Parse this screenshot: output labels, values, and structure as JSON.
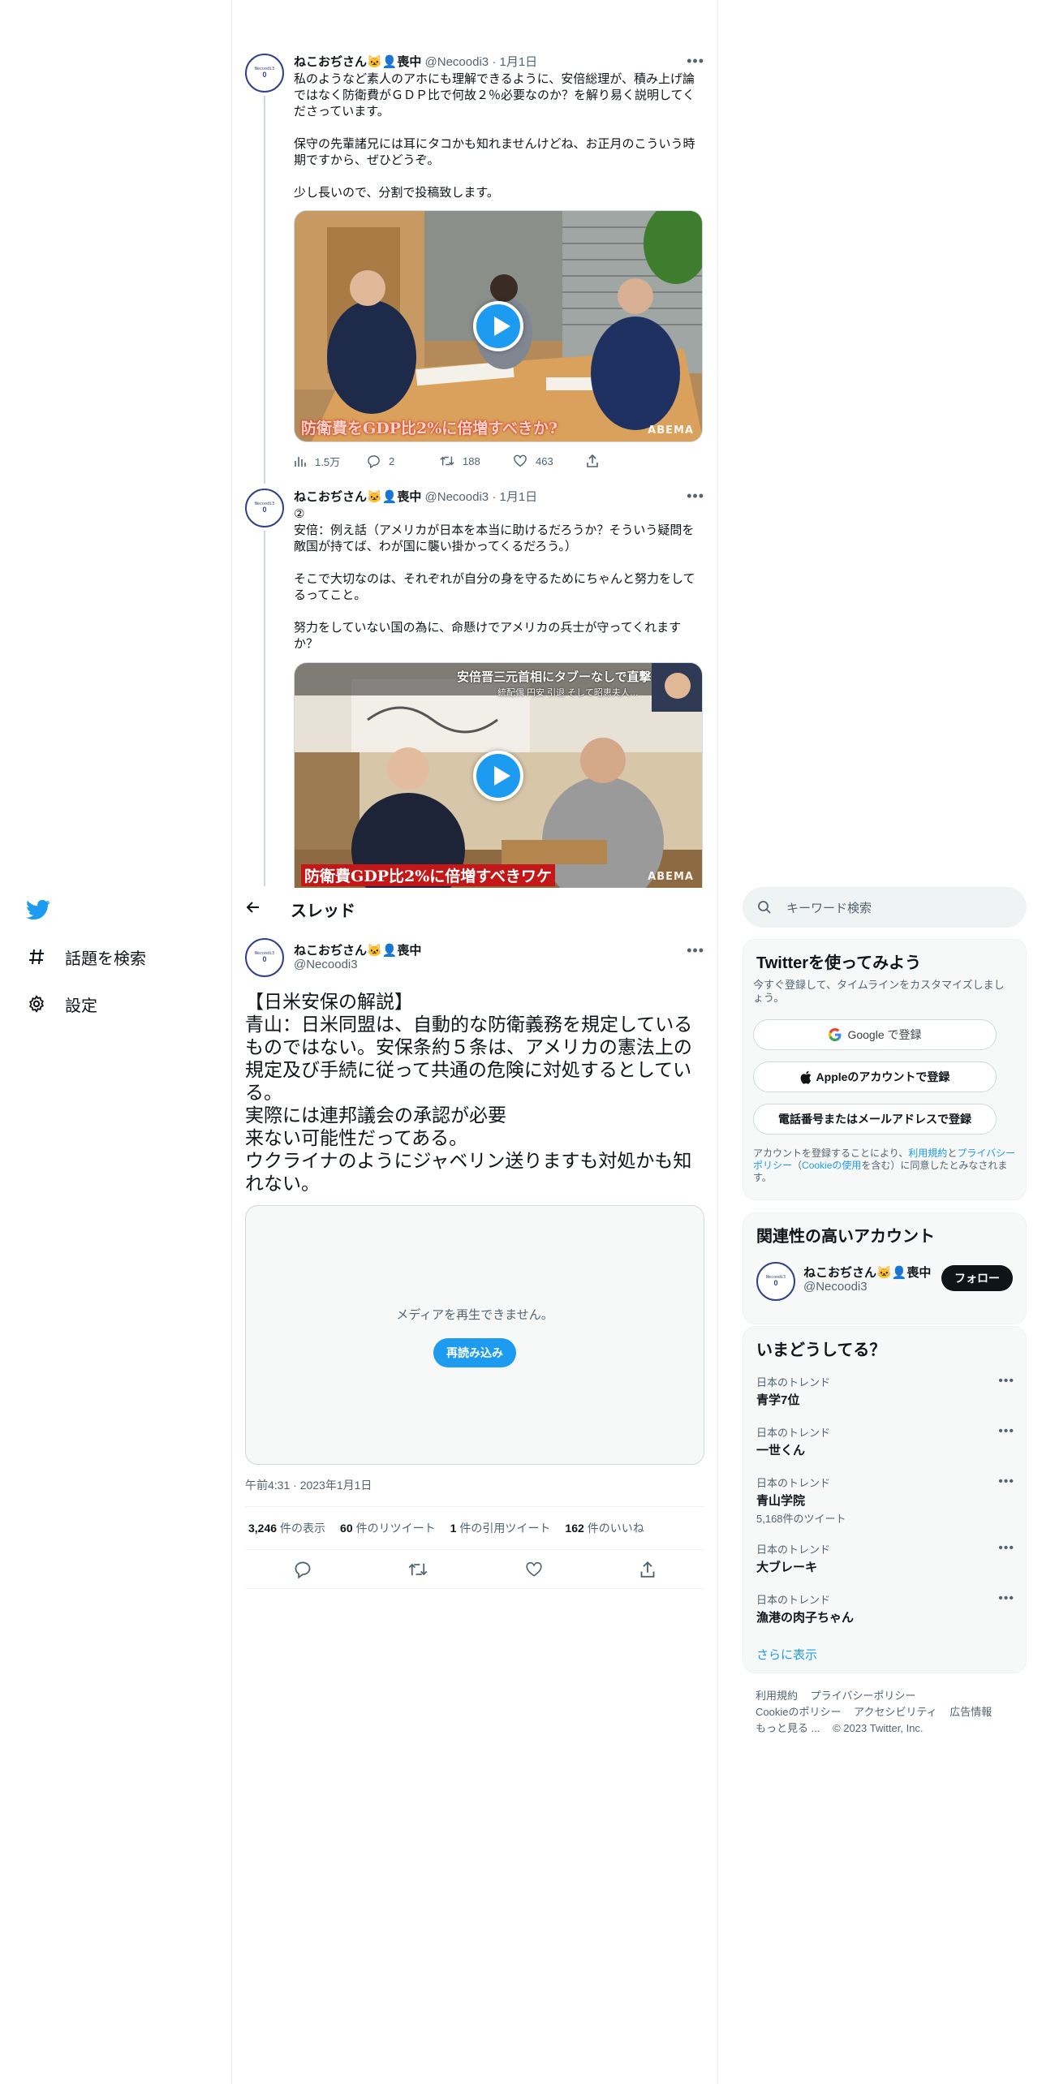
{
  "nav": {
    "items": [
      {
        "label": "話題を検索",
        "icon": "hash-icon"
      },
      {
        "label": "設定",
        "icon": "gear-icon"
      }
    ]
  },
  "tweets": [
    {
      "author": "ねこおぢさん🐱‍👤喪中",
      "handle": "@Necoodi3",
      "date": "· 1月1日",
      "avatar_text": "Necoodi3",
      "avatar_num": "0",
      "text": "私のようなど素人のアホにも理解できるように、安倍総理が、積み上げ論ではなく防衛費がＧＤＰ比で何故２％必要なのか？を解り易く説明してくださっています。\n\n保守の先輩諸兄には耳にタコかも知れませんけどね、お正月のこういう時期ですから、ぜひどうぞ。\n\n少し長いので、分割で投稿致します。",
      "media_caption": "防衛費をGDP比2%に倍増すべきか?",
      "media_brand": "ABEMA",
      "views": "1.5万",
      "replies": "2",
      "retweets": "188",
      "likes": "463"
    },
    {
      "author": "ねこおぢさん🐱‍👤喪中",
      "handle": "@Necoodi3",
      "date": "· 1月1日",
      "avatar_text": "Necoodi3",
      "avatar_num": "0",
      "text": "②\n安倍：例え話（アメリカが日本を本当に助けるだろうか？そういう疑問を敵国が持てば、わが国に襲い掛かってくるだろう。）\n\nそこで大切なのは、それぞれが自分の身を守るためにちゃんと努力をしてるってこと。\n\n努力をしていない国の為に、命懸けでアメリカの兵士が守ってくれますか？",
      "media_top_caption": "安倍晋三元首相にタブーなしで直撃",
      "media_sub_caption": "統配偶 円安 引退 そして昭恵夫人…",
      "media_caption": "防衛費GDP比2%に倍増すべきワケ",
      "media_brand": "ABEMA"
    }
  ],
  "thread": {
    "title": "スレッド",
    "author": "ねこおぢさん🐱‍👤喪中",
    "handle": "@Necoodi3",
    "avatar_text": "Necoodi3",
    "avatar_num": "0",
    "text": "【日米安保の解説】\n青山：日米同盟は、自動的な防衛義務を規定しているものではない。安保条約５条は、アメリカの憲法上の規定及び手続に従って共通の危険に対処するとしている。\n実際には連邦議会の承認が必要\n来ない可能性だってある。\nウクライナのようにジャベリン送りますも対処かも知れない。",
    "media_error": "メディアを再生できません。",
    "reload_label": "再読み込み",
    "timestamp": "午前4:31 · 2023年1月1日",
    "stats": [
      {
        "num": "3,246",
        "label": "件の表示"
      },
      {
        "num": "60",
        "label": "件のリツイート"
      },
      {
        "num": "1",
        "label": "件の引用ツイート"
      },
      {
        "num": "162",
        "label": "件のいいね"
      }
    ]
  },
  "sidebar": {
    "search_placeholder": "キーワード検索",
    "signup": {
      "title": "Twitterを使ってみよう",
      "subtitle": "今すぐ登録して、タイムラインをカスタマイズしましょう。",
      "google": "Google で登録",
      "apple": "Appleのアカウントで登録",
      "phone": "電話番号またはメールアドレスで登録",
      "terms_pre": "アカウントを登録することにより、",
      "terms_link1": "利用規約",
      "terms_mid": "と",
      "terms_link2": "プライバシーポリシー",
      "terms_paren_open": "（",
      "terms_link3": "Cookieの使用",
      "terms_post": "を含む）に同意したとみなされます。"
    },
    "related": {
      "title": "関連性の高いアカウント",
      "name": "ねこおぢさん🐱‍👤喪中",
      "handle": "@Necoodi3",
      "avatar_text": "Necoodi3",
      "avatar_num": "0",
      "follow": "フォロー"
    },
    "trends": {
      "title": "いまどうしてる？",
      "items": [
        {
          "context": "日本のトレンド",
          "name": "青学7位",
          "count": ""
        },
        {
          "context": "日本のトレンド",
          "name": "一世くん",
          "count": ""
        },
        {
          "context": "日本のトレンド",
          "name": "青山学院",
          "count": "5,168件のツイート"
        },
        {
          "context": "日本のトレンド",
          "name": "大ブレーキ",
          "count": ""
        },
        {
          "context": "日本のトレンド",
          "name": "漁港の肉子ちゃん",
          "count": ""
        }
      ],
      "show_more": "さらに表示"
    },
    "footer": {
      "terms": "利用規約",
      "privacy": "プライバシーポリシー",
      "cookie": "Cookieのポリシー",
      "accessibility": "アクセシビリティ",
      "ads": "広告情報",
      "more": "もっと見る ...",
      "copyright": "© 2023 Twitter, Inc."
    }
  },
  "colors": {
    "accent": "#1d9bf0",
    "text": "#0f1419",
    "muted": "#536471",
    "border": "#eff3f4"
  }
}
